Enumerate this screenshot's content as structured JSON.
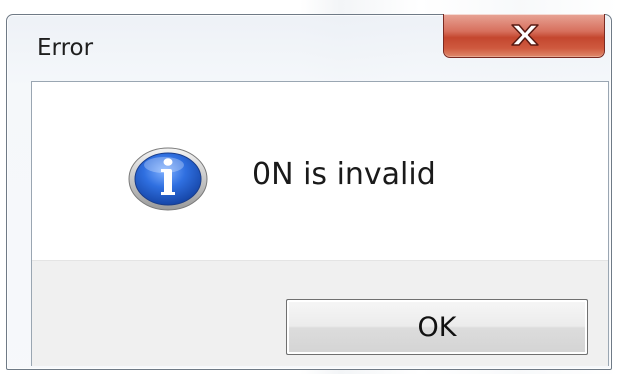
{
  "dialog": {
    "title": "Error",
    "close_icon": "close-x-icon",
    "message": "0N is invalid",
    "message_icon": "information-icon",
    "ok_label": "OK",
    "colors": {
      "close_button": "#c4472f",
      "info_icon": "#1f5fc4"
    }
  }
}
